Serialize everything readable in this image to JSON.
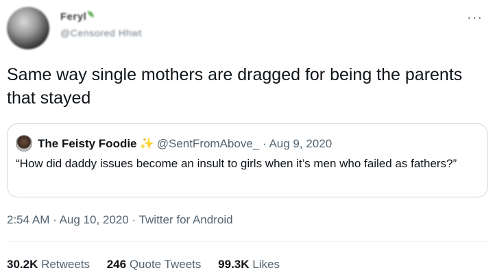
{
  "author": {
    "display_name": "Feryl",
    "handle": "@Censored Hhwt",
    "badge_icon": "leaf-icon"
  },
  "tweet": {
    "text": "Same way single mothers are dragged for being the parents that stayed"
  },
  "quoted": {
    "name": "The Feisty Foodie",
    "emoji_icon": "sparkles-icon",
    "handle": "@SentFromAbove_",
    "separator": "·",
    "date": "Aug 9, 2020",
    "text": "“How did daddy issues become an insult to girls when it’s men who failed as fathers?”"
  },
  "meta": {
    "time": "2:54 AM",
    "sep1": "·",
    "date": "Aug 10, 2020",
    "sep2": "·",
    "source": "Twitter for Android"
  },
  "stats": {
    "retweets_count": "30.2K",
    "retweets_label": "Retweets",
    "quotes_count": "246",
    "quotes_label": "Quote Tweets",
    "likes_count": "99.3K",
    "likes_label": "Likes"
  },
  "colors": {
    "text": "#0f1419",
    "secondary": "#536471",
    "border": "#cfd9de",
    "sparkle": "#f5c518"
  }
}
